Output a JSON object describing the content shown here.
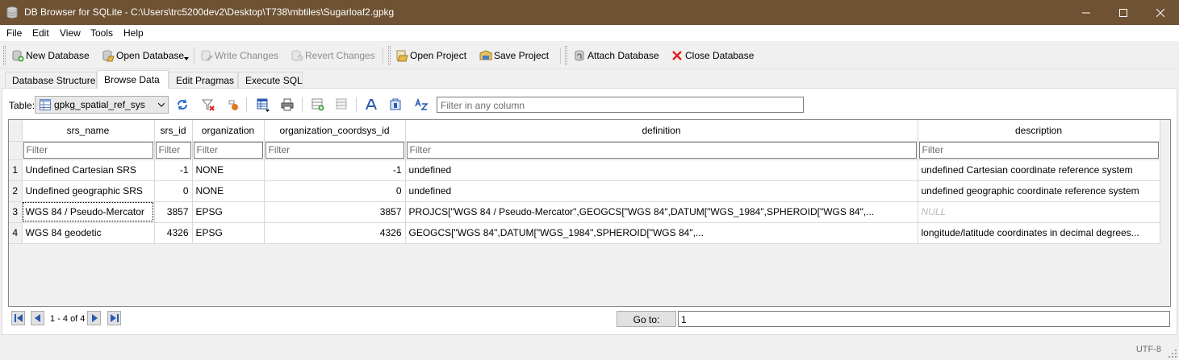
{
  "window": {
    "title": "DB Browser for SQLite - C:\\Users\\trc5200dev2\\Desktop\\T738\\mbtiles\\Sugarloaf2.gpkg",
    "title_bar_color": "#6e5233"
  },
  "menu": [
    "File",
    "Edit",
    "View",
    "Tools",
    "Help"
  ],
  "toolbar": {
    "new_database": "New Database",
    "open_database": "Open Database",
    "write_changes": "Write Changes",
    "revert_changes": "Revert Changes",
    "open_project": "Open Project",
    "save_project": "Save Project",
    "attach_database": "Attach Database",
    "close_database": "Close Database"
  },
  "tabs": [
    {
      "label": "Database Structure",
      "active": false
    },
    {
      "label": "Browse Data",
      "active": true
    },
    {
      "label": "Edit Pragmas",
      "active": false
    },
    {
      "label": "Execute SQL",
      "active": false
    }
  ],
  "browse": {
    "table_label": "Table:",
    "table_value": "gpkg_spatial_ref_sys",
    "filter_all_placeholder": "Filter in any column",
    "filter_placeholder": "Filter"
  },
  "grid": {
    "columns": [
      "srs_name",
      "srs_id",
      "organization",
      "organization_coordsys_id",
      "definition",
      "description"
    ],
    "rows": [
      {
        "num": "1",
        "cells": [
          "Undefined Cartesian SRS",
          "-1",
          "NONE",
          "-1",
          "undefined",
          "undefined Cartesian coordinate reference system"
        ]
      },
      {
        "num": "2",
        "cells": [
          "Undefined geographic SRS",
          "0",
          "NONE",
          "0",
          "undefined",
          "undefined geographic coordinate reference system"
        ]
      },
      {
        "num": "3",
        "cells": [
          "WGS 84 / Pseudo-Mercator",
          "3857",
          "EPSG",
          "3857",
          "PROJCS[\"WGS 84 / Pseudo-Mercator\",GEOGCS[\"WGS 84\",DATUM[\"WGS_1984\",SPHEROID[\"WGS 84\",...",
          "NULL"
        ]
      },
      {
        "num": "4",
        "cells": [
          "WGS 84 geodetic",
          "4326",
          "EPSG",
          "4326",
          "GEOGCS[\"WGS 84\",DATUM[\"WGS_1984\",SPHEROID[\"WGS 84\",...",
          "longitude/latitude coordinates in decimal degrees..."
        ]
      }
    ]
  },
  "navigation": {
    "record_count": "1 - 4 of 4",
    "goto_label": "Go to:",
    "goto_value": "1"
  },
  "status": {
    "encoding": "UTF-8"
  }
}
